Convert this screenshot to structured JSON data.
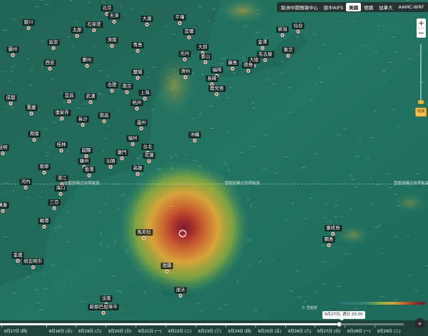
{
  "model_tabs": [
    {
      "label": "歐洲中期預報中心",
      "active": false
    },
    {
      "label": "歐中AIFS",
      "active": false
    },
    {
      "label": "美國",
      "active": true
    },
    {
      "label": "德國",
      "active": false
    },
    {
      "label": "加拿大",
      "active": false
    },
    {
      "label": "AAMC-WRF",
      "active": false
    }
  ],
  "controls": {
    "zoom_in": "+",
    "zoom_out": "−",
    "layer_badge": "地面",
    "play": "»"
  },
  "lat_lines": [
    "雪龍號模式熱帶氣旋",
    "雪龍號模式熱帶氣旋",
    "雪龍號模式熱帶氣旋"
  ],
  "cities": [
    {
      "name": "北京",
      "ix": 150,
      "iy": 7
    },
    {
      "name": "天津",
      "ix": 160,
      "iy": 18
    },
    {
      "name": "平壤",
      "ix": 252,
      "iy": 20
    },
    {
      "name": "大連",
      "ix": 206,
      "iy": 22
    },
    {
      "name": "石家莊",
      "ix": 132,
      "iy": 30
    },
    {
      "name": "太原",
      "ix": 108,
      "iy": 38
    },
    {
      "name": "濟南",
      "ix": 157,
      "iy": 52
    },
    {
      "name": "首爾",
      "ix": 265,
      "iy": 40
    },
    {
      "name": "青島",
      "ix": 193,
      "iy": 59
    },
    {
      "name": "銀川",
      "ix": 40,
      "iy": 27
    },
    {
      "name": "蘭州",
      "ix": 18,
      "iy": 65
    },
    {
      "name": "延安",
      "ix": 75,
      "iy": 55
    },
    {
      "name": "鄭州",
      "ix": 122,
      "iy": 80
    },
    {
      "name": "西安",
      "ix": 70,
      "iy": 84
    },
    {
      "name": "光州",
      "ix": 259,
      "iy": 71
    },
    {
      "name": "大邱",
      "ix": 284,
      "iy": 62
    },
    {
      "name": "釜山",
      "ix": 288,
      "iy": 75
    },
    {
      "name": "新潟",
      "ix": 396,
      "iy": 37
    },
    {
      "name": "仙台",
      "ix": 418,
      "iy": 32
    },
    {
      "name": "金澤",
      "ix": 368,
      "iy": 55
    },
    {
      "name": "名古屋",
      "ix": 372,
      "iy": 72
    },
    {
      "name": "東京",
      "ix": 404,
      "iy": 66
    },
    {
      "name": "大阪",
      "ix": 356,
      "iy": 80
    },
    {
      "name": "廣島",
      "ix": 326,
      "iy": 84
    },
    {
      "name": "德島",
      "ix": 348,
      "iy": 87
    },
    {
      "name": "福岡",
      "ix": 304,
      "iy": 94
    },
    {
      "name": "濟州",
      "ix": 260,
      "iy": 96
    },
    {
      "name": "長崎",
      "ix": 297,
      "iy": 106
    },
    {
      "name": "鹿兒島",
      "ix": 304,
      "iy": 120
    },
    {
      "name": "鹽城",
      "ix": 193,
      "iy": 97
    },
    {
      "name": "合肥",
      "ix": 157,
      "iy": 115
    },
    {
      "name": "南京",
      "ix": 178,
      "iy": 117
    },
    {
      "name": "上海",
      "ix": 203,
      "iy": 126
    },
    {
      "name": "宜昌",
      "ix": 97,
      "iy": 130
    },
    {
      "name": "武漢",
      "ix": 127,
      "iy": 131
    },
    {
      "name": "杭州",
      "ix": 192,
      "iy": 140
    },
    {
      "name": "成都",
      "ix": 15,
      "iy": 133
    },
    {
      "name": "重慶",
      "ix": 44,
      "iy": 147
    },
    {
      "name": "張家界",
      "ix": 87,
      "iy": 154
    },
    {
      "name": "長沙",
      "ix": 116,
      "iy": 163
    },
    {
      "name": "南昌",
      "ix": 146,
      "iy": 158
    },
    {
      "name": "溫州",
      "ix": 198,
      "iy": 168
    },
    {
      "name": "貴陽",
      "ix": 48,
      "iy": 184
    },
    {
      "name": "沖繩",
      "ix": 273,
      "iy": 185
    },
    {
      "name": "福州",
      "ix": 186,
      "iy": 190
    },
    {
      "name": "桂林",
      "ix": 86,
      "iy": 199
    },
    {
      "name": "韶關",
      "ix": 121,
      "iy": 207
    },
    {
      "name": "台北",
      "ix": 207,
      "iy": 202
    },
    {
      "name": "廈門",
      "ix": 171,
      "iy": 210
    },
    {
      "name": "花蓮",
      "ix": 209,
      "iy": 214
    },
    {
      "name": "昆明",
      "ix": 4,
      "iy": 203
    },
    {
      "name": "廣州",
      "ix": 118,
      "iy": 222
    },
    {
      "name": "汕頭",
      "ix": 155,
      "iy": 222
    },
    {
      "name": "南寧",
      "ix": 62,
      "iy": 230
    },
    {
      "name": "香港",
      "ix": 125,
      "iy": 234
    },
    {
      "name": "高雄",
      "ix": 193,
      "iy": 232
    },
    {
      "name": "湛江",
      "ix": 87,
      "iy": 246
    },
    {
      "name": "河內",
      "ix": 36,
      "iy": 251
    },
    {
      "name": "海口",
      "ix": 85,
      "iy": 260
    },
    {
      "name": "三亞",
      "ix": 76,
      "iy": 280
    },
    {
      "name": "萬象",
      "ix": 4,
      "iy": 284
    },
    {
      "name": "峴港",
      "ix": 62,
      "iy": 306
    },
    {
      "name": "馬尼拉",
      "ix": 202,
      "iy": 322
    },
    {
      "name": "塞班島",
      "ix": 467,
      "iy": 316
    },
    {
      "name": "關島",
      "ix": 461,
      "iy": 332
    },
    {
      "name": "金邊",
      "ix": 25,
      "iy": 354
    },
    {
      "name": "胡志明市",
      "ix": 46,
      "iy": 363
    },
    {
      "name": "宿霧",
      "ix": 234,
      "iy": 369
    },
    {
      "name": "汶萊",
      "ix": 149,
      "iy": 415
    },
    {
      "name": "新那巴加灣市",
      "ix": 145,
      "iy": 427
    },
    {
      "name": "達沃",
      "ix": 253,
      "iy": 403
    }
  ],
  "legend": {
    "credit": "© 雪龍號"
  },
  "timeline": {
    "tooltip": "9月27日, 週日 20:00",
    "progress": 0.84,
    "days": [
      {
        "label": "9月17日 (四)",
        "ix": 22
      },
      {
        "label": "9月18日 (五)",
        "ix": 85
      },
      {
        "label": "9月19日 (六)",
        "ix": 126
      },
      {
        "label": "9月20日 (日)",
        "ix": 168
      },
      {
        "label": "9月21日 (一)",
        "ix": 210
      },
      {
        "label": "9月22日 (二)",
        "ix": 252
      },
      {
        "label": "9月23日 (三)",
        "ix": 294
      },
      {
        "label": "9月24日 (四)",
        "ix": 336
      },
      {
        "label": "9月25日 (五)",
        "ix": 378
      },
      {
        "label": "9月26日 (六)",
        "ix": 420
      },
      {
        "label": "9月27日 (日)",
        "ix": 461
      },
      {
        "label": "9月28日 (一)",
        "ix": 503
      },
      {
        "label": "9月29日 (二)",
        "ix": 545
      }
    ]
  }
}
